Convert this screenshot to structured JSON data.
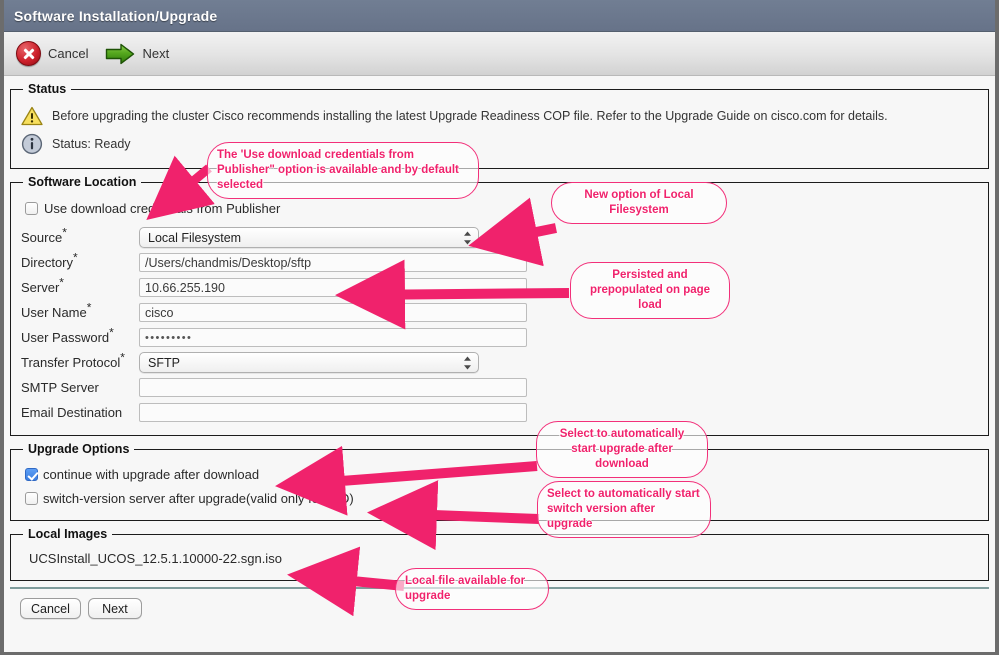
{
  "window": {
    "title": "Software Installation/Upgrade"
  },
  "toolbar": {
    "cancel_label": "Cancel",
    "next_label": "Next",
    "cancel_icon": "cancel-circle-icon",
    "next_icon": "green-arrow-right-icon"
  },
  "status": {
    "legend": "Status",
    "warning_icon": "warning-triangle-icon",
    "warning_text": "Before upgrading the cluster Cisco recommends installing the latest Upgrade Readiness COP file. Refer to the Upgrade Guide on cisco.com for details.",
    "info_icon": "info-circle-icon",
    "status_text": "Status: Ready"
  },
  "software_location": {
    "legend": "Software Location",
    "use_publisher_credentials": {
      "label": "Use download credentials from Publisher",
      "checked": false
    },
    "fields": [
      {
        "label": "Source",
        "required": true,
        "type": "select",
        "value": "Local Filesystem"
      },
      {
        "label": "Directory",
        "required": true,
        "type": "text",
        "value": "/Users/chandmis/Desktop/sftp"
      },
      {
        "label": "Server",
        "required": true,
        "type": "text",
        "value": "10.66.255.190"
      },
      {
        "label": "User Name",
        "required": true,
        "type": "text",
        "value": "cisco"
      },
      {
        "label": "User Password",
        "required": true,
        "type": "password",
        "value": "•••••••••"
      },
      {
        "label": "Transfer Protocol",
        "required": true,
        "type": "select",
        "value": "SFTP"
      },
      {
        "label": "SMTP Server",
        "required": false,
        "type": "text",
        "value": ""
      },
      {
        "label": "Email Destination",
        "required": false,
        "type": "text",
        "value": ""
      }
    ]
  },
  "upgrade_options": {
    "legend": "Upgrade Options",
    "options": [
      {
        "label": "continue with upgrade after download",
        "checked": true
      },
      {
        "label": "switch-version server after upgrade(valid only for ISO)",
        "checked": false
      }
    ]
  },
  "local_images": {
    "legend": "Local Images",
    "items": [
      "UCSInstall_UCOS_12.5.1.10000-22.sgn.iso"
    ]
  },
  "footer": {
    "cancel_label": "Cancel",
    "next_label": "Next"
  },
  "annotations": [
    {
      "id": "a1",
      "text": "The 'Use download credentials from Publisher\" option is available and by default selected"
    },
    {
      "id": "a2",
      "text": "New option of Local Filesystem"
    },
    {
      "id": "a3",
      "text": "Persisted and prepopulated on page load"
    },
    {
      "id": "a4",
      "text": "Select to automatically start  upgrade after download"
    },
    {
      "id": "a5",
      "text": "Select to automatically start switch version after upgrade"
    },
    {
      "id": "a6",
      "text": "Local file available for upgrade"
    }
  ],
  "colors": {
    "titlebar": "#68748a",
    "annotation_pink": "#f0226c",
    "checkbox_blue": "#3b7de0",
    "footer_rule": "#7e9b9b"
  }
}
